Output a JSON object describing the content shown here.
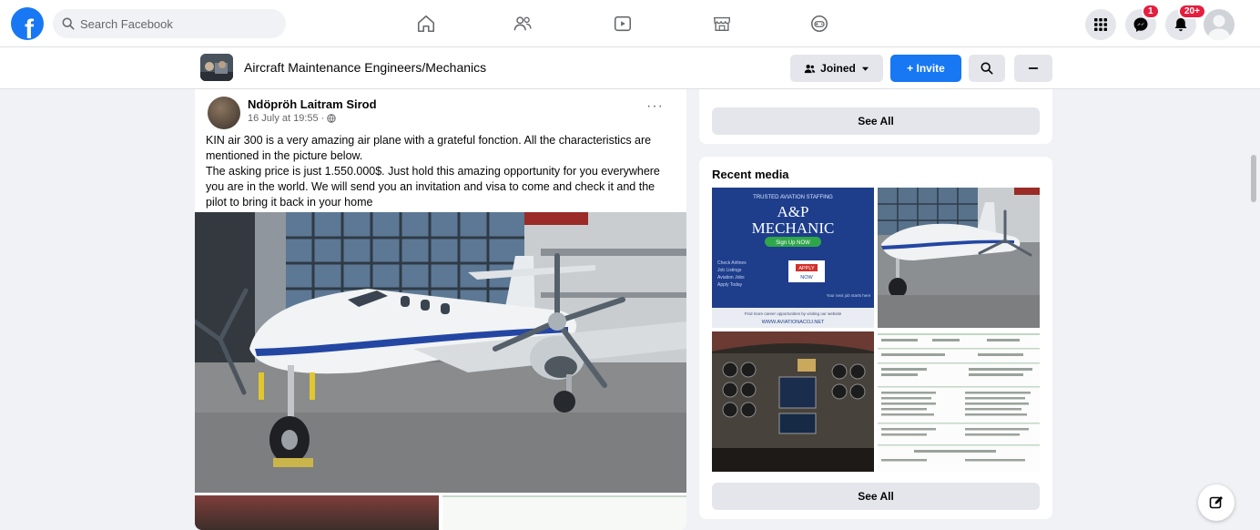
{
  "topbar": {
    "logo_letter": "f",
    "search_placeholder": "Search Facebook",
    "nav": [
      "home-icon",
      "friends-icon",
      "watch-icon",
      "marketplace-icon",
      "gaming-icon"
    ],
    "messenger_badge": "1",
    "notifications_badge": "20+"
  },
  "group": {
    "name": "Aircraft Maintenance Engineers/Mechanics",
    "joined_label": "Joined",
    "invite_label": "+ Invite"
  },
  "post": {
    "author": "Ndöpröh Laitram Sirod",
    "timestamp": "16 July at 19:55 ·",
    "more": "···",
    "text_lines": [
      "KIN air 300 is a very amazing air plane with a grateful fonction. All the characteristics are mentioned in the picture below.",
      "The asking price is just 1.550.000$. Just hold this amazing opportunity for you everywhere you are in the world. We will send you an invitation and visa to come and check it and the pilot to bring it back in your home"
    ]
  },
  "sidebar": {
    "see_all_1": "See All",
    "recent_media_title": "Recent media",
    "see_all_2": "See All",
    "media_poster": {
      "brand": "TRUSTED AVIATION STAFFING",
      "headline_1": "A&P",
      "headline_2": "MECHANIC",
      "pill": "Sign Up NOW",
      "left_list": [
        "Check Airlines",
        "Job Listings",
        "Aviation Jobs",
        "Apply Today"
      ],
      "mid_box": [
        "APPLY",
        "NOW"
      ],
      "right_note": "Your next job starts here",
      "footer_note": "Find more career opportunities by visiting our website",
      "url": "WWW.AVIATIONACOJ.NET"
    }
  },
  "colors": {
    "brand": "#1877f2",
    "badge": "#e41e3f",
    "page_bg": "#f0f2f5"
  }
}
